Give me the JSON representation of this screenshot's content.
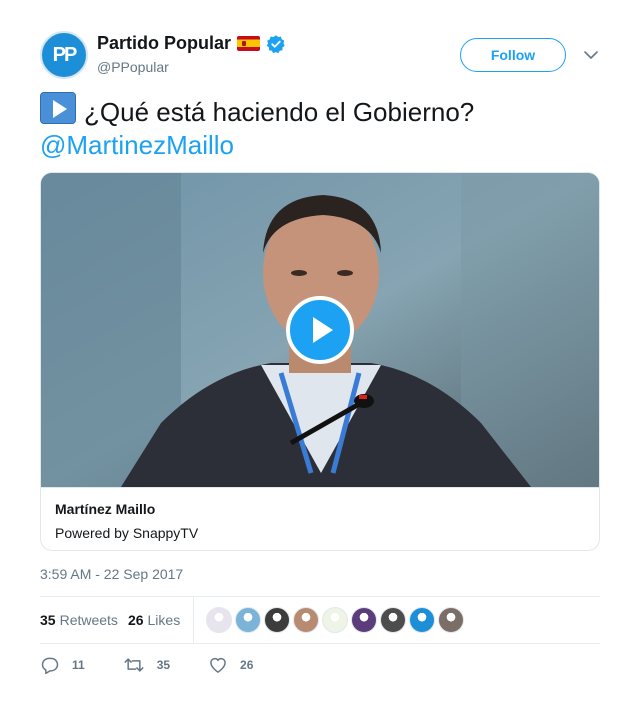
{
  "author": {
    "name": "Partido Popular",
    "handle": "@PPopular",
    "avatar_text": "PP",
    "flag_icon": "spain-flag-icon",
    "verified_icon": "verified-badge-icon"
  },
  "header": {
    "follow_label": "Follow",
    "menu_icon": "chevron-down-icon"
  },
  "tweet": {
    "emoji_icon": "play-button-emoji-icon",
    "text": "¿Qué está haciendo el Gobierno?",
    "mention": "@MartinezMaillo"
  },
  "card": {
    "title": "Martínez Maillo",
    "subtitle": "Powered by SnappyTV",
    "play_icon": "play-icon"
  },
  "timestamp": "3:59 AM - 22 Sep 2017",
  "stats": {
    "retweets_count": "35",
    "retweets_label": "Retweets",
    "likes_count": "26",
    "likes_label": "Likes"
  },
  "liker_faces": [
    {
      "icon": "liker-avatar-1",
      "color": "#e8e4ee"
    },
    {
      "icon": "liker-avatar-2",
      "color": "#7bb3d9"
    },
    {
      "icon": "liker-avatar-3",
      "color": "#3c3c3c"
    },
    {
      "icon": "liker-avatar-4",
      "color": "#b98a72"
    },
    {
      "icon": "liker-avatar-5",
      "color": "#eef5e6"
    },
    {
      "icon": "liker-avatar-6",
      "color": "#5a3d7a"
    },
    {
      "icon": "liker-avatar-7",
      "color": "#4d4d4d"
    },
    {
      "icon": "liker-avatar-8",
      "color": "#1d8fd8"
    },
    {
      "icon": "liker-avatar-9",
      "color": "#7a6e66"
    }
  ],
  "actions": {
    "reply_count": "11",
    "retweet_count": "35",
    "like_count": "26"
  },
  "colors": {
    "accent": "#1da1f2",
    "secondary_text": "#657786",
    "primary_text": "#14171a"
  }
}
